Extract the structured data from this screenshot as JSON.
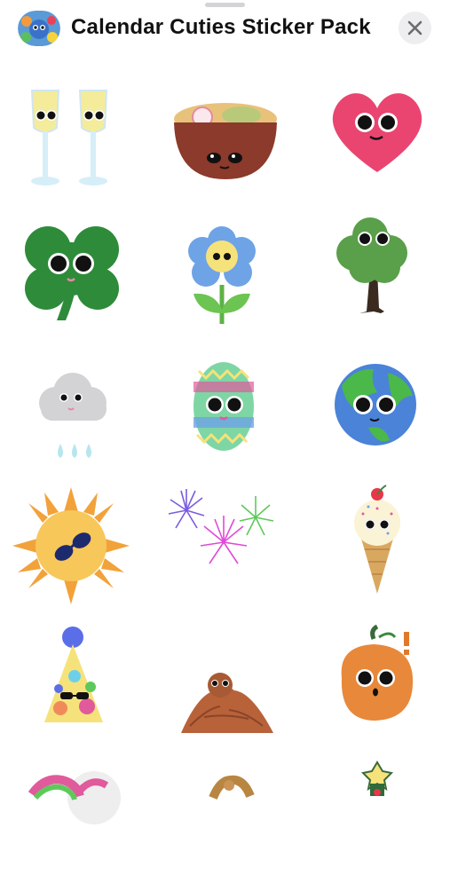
{
  "header": {
    "title": "Calendar Cuties Sticker Pack",
    "app_icon": "calendar-cuties-app-icon",
    "close_icon": "close-x-icon"
  },
  "stickers": [
    {
      "name": "champagne-glasses-sticker"
    },
    {
      "name": "ramen-bowl-sticker"
    },
    {
      "name": "heart-sticker"
    },
    {
      "name": "four-leaf-clover-sticker"
    },
    {
      "name": "blue-flower-sticker"
    },
    {
      "name": "tree-sticker"
    },
    {
      "name": "rain-cloud-sticker"
    },
    {
      "name": "easter-egg-sticker"
    },
    {
      "name": "earth-globe-sticker"
    },
    {
      "name": "sun-with-sunglasses-sticker"
    },
    {
      "name": "fireworks-sticker"
    },
    {
      "name": "ice-cream-cone-sticker"
    },
    {
      "name": "party-hat-sticker"
    },
    {
      "name": "leaf-pile-sticker"
    },
    {
      "name": "pumpkin-sticker"
    },
    {
      "name": "partial-sticker-1"
    },
    {
      "name": "partial-sticker-2"
    },
    {
      "name": "partial-sticker-3"
    }
  ],
  "colors": {
    "background": "#ffffff",
    "close_button_bg": "#eeeef0",
    "grabber": "#d4d4d6",
    "title": "#111111"
  }
}
